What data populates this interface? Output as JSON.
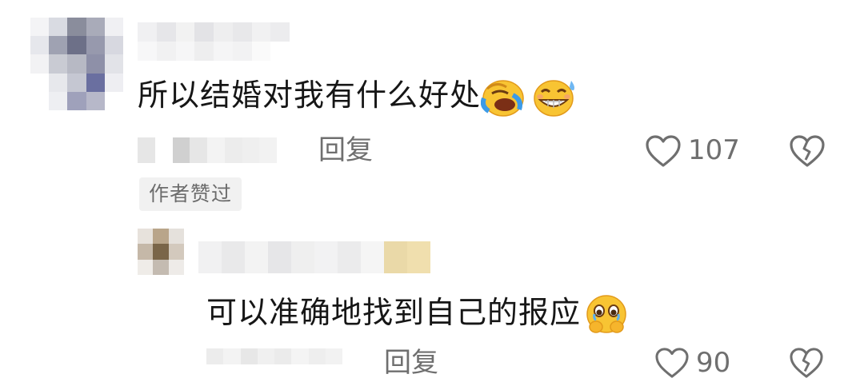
{
  "comment": {
    "text": "所以结婚对我有什么好处",
    "emojis": [
      "face-with-tears-of-joy-icon",
      "grinning-sweat-icon"
    ],
    "reply_label": "回复",
    "like_count": "107",
    "author_liked_badge": "作者赞过"
  },
  "reply": {
    "text": "可以准确地找到自己的报应",
    "emojis": [
      "holding-back-tears-icon"
    ],
    "reply_label": "回复",
    "like_count": "90"
  },
  "colors": {
    "text": "#161616",
    "meta": "#6f6f6f",
    "badge_bg": "#f1f1f1"
  }
}
